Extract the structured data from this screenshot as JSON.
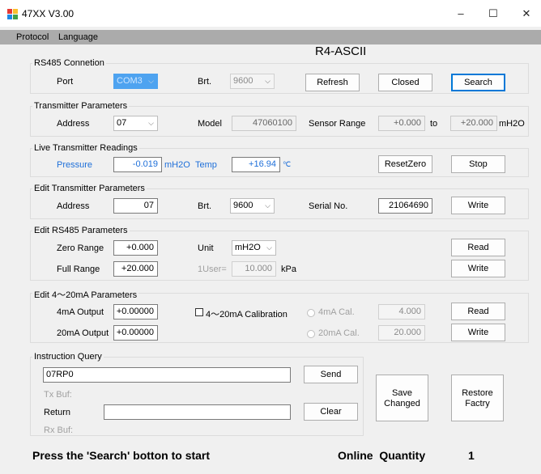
{
  "window": {
    "title": "47XX V3.00",
    "minimize": "–",
    "maximize": "☐",
    "close": "✕"
  },
  "menu": {
    "protocol": "Protocol",
    "language": "Language"
  },
  "mode_label": "R4-ASCII",
  "rs485": {
    "legend": "RS485 Connetion",
    "port_label": "Port",
    "port_value": "COM3",
    "brt_label": "Brt.",
    "brt_value": "9600",
    "refresh": "Refresh",
    "closed": "Closed",
    "search": "Search"
  },
  "transmitter": {
    "legend": "Transmitter Parameters",
    "address_label": "Address",
    "address_value": "07",
    "model_label": "Model",
    "model_value": "47060100",
    "range_label": "Sensor Range",
    "range_min": "+0.000",
    "to_label": "to",
    "range_max": "+20.000",
    "unit": "mH2O"
  },
  "live": {
    "legend": "Live Transmitter Readings",
    "pressure_label": "Pressure",
    "pressure_value": "-0.019",
    "pressure_unit": "mH2O",
    "temp_label": "Temp",
    "temp_value": "+16.94",
    "temp_unit": "℃",
    "reset_zero": "ResetZero",
    "stop": "Stop"
  },
  "edit_transmitter": {
    "legend": "Edit Transmitter Parameters",
    "address_label": "Address",
    "address_value": "07",
    "brt_label": "Brt.",
    "brt_value": "9600",
    "serial_label": "Serial No.",
    "serial_value": "21064690",
    "write": "Write"
  },
  "edit_rs485": {
    "legend": "Edit RS485 Parameters",
    "zero_label": "Zero Range",
    "zero_value": "+0.000",
    "unit_label": "Unit",
    "unit_value": "mH2O",
    "read": "Read",
    "full_label": "Full Range",
    "full_value": "+20.000",
    "user_label": "1User=",
    "user_value": "10.000",
    "user_unit": "kPa",
    "write": "Write"
  },
  "edit_ma": {
    "legend": "Edit 4～20mA Parameters",
    "out4_label": "4mA Output",
    "out4_value": "+0.00000",
    "calib_label": "4～20mA Calibration",
    "cal4_label": "4mA Cal.",
    "cal4_value": "4.000",
    "read": "Read",
    "out20_label": "20mA Output",
    "out20_value": "+0.00000",
    "cal20_label": "20mA Cal.",
    "cal20_value": "20.000",
    "write": "Write"
  },
  "query": {
    "legend": "Instruction Query",
    "command_value": "07RP0",
    "send": "Send",
    "txbuf_label": "Tx Buf:",
    "return_label": "Return",
    "return_value": "",
    "clear": "Clear",
    "rxbuf_label": "Rx Buf:"
  },
  "save_changed": [
    "Save",
    "Changed"
  ],
  "restore_factry": [
    "Restore",
    "Factry"
  ],
  "status": {
    "message": "Press the 'Search' botton to start",
    "online_label": "Online  Quantity",
    "online_value": "1"
  },
  "colors": {
    "accent_blue": "#1e6fd9",
    "menubar": "#ababab",
    "focus_border": "#0078d7"
  }
}
